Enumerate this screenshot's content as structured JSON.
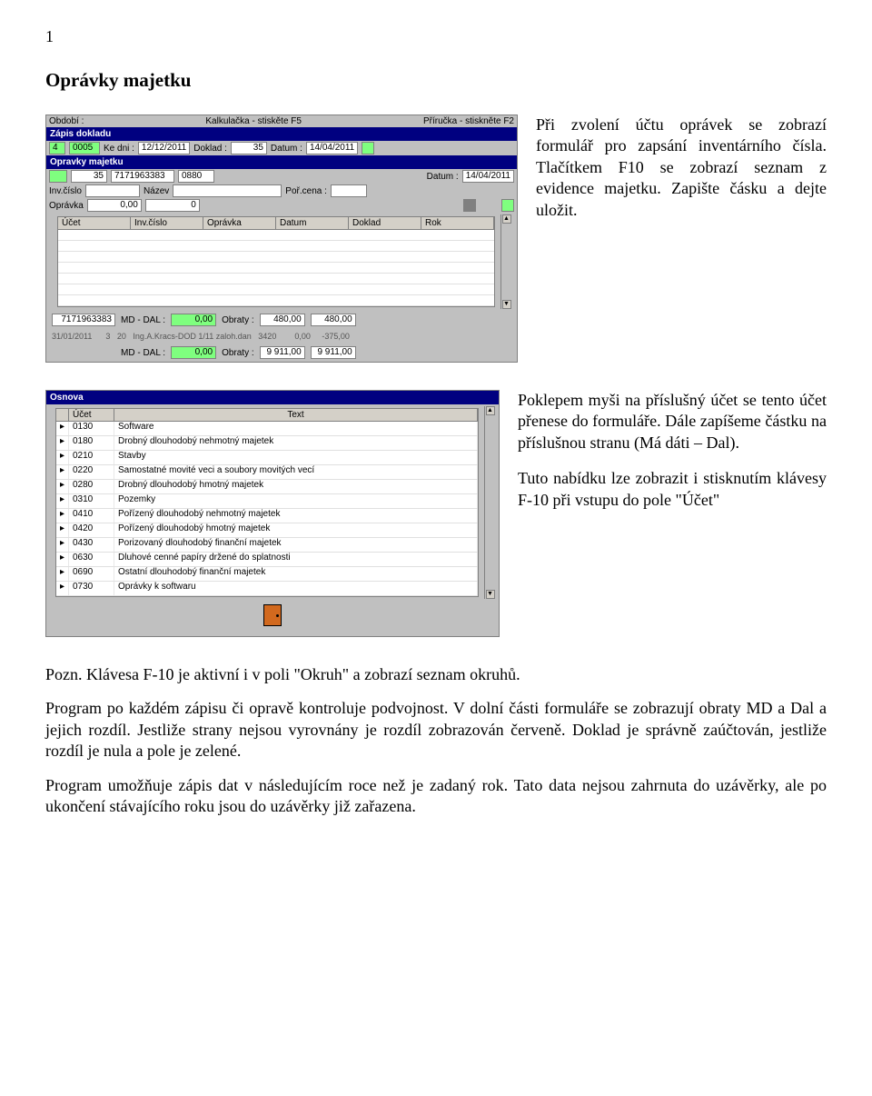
{
  "page_number": "1",
  "title": "Oprávky majetku",
  "para1": "Při zvolení účtu oprávek se zobrazí formulář pro zapsání inventárního čísla. Tlačítkem F10 se zobrazí seznam z evidence majetku. Zapište čásku a dejte uložit.",
  "para2": "Poklepem myši na příslušný účet se tento účet přenese do formuláře. Dále zapíšeme částku na příslušnou stranu (Má dáti – Dal).",
  "para3": "Tuto nabídku lze zobrazit i stisknutím klávesy F-10 při vstupu do pole \"Účet\"",
  "pozn": "Pozn. Klávesa F-10 je aktivní i v poli \"Okruh\" a zobrazí seznam okruhů.",
  "body1": "Program po každém zápisu či opravě kontroluje podvojnost. V dolní části formuláře se zobrazují obraty MD a Dal a jejich rozdíl. Jestliže strany nejsou vyrovnány je rozdíl zobrazován červeně. Doklad je správně zaúčtován, jestliže rozdíl je nula a pole je zelené.",
  "body2": "Program umožňuje zápis dat v následujícím roce než je zadaný rok. Tato data nejsou zahrnuta do uzávěrky, ale po ukončení stávajícího roku jsou do uzávěrky již zařazena.",
  "shot1": {
    "top_labels": {
      "obdobi": "Období :",
      "kalk": "Kalkulačka - stiskěte F5",
      "prir": "Příručka - stiskněte F2"
    },
    "titlebar_zapis": "Zápis dokladu",
    "row_zapis": {
      "f1": "4",
      "f2": "0005",
      "kedni_l": "Ke dni :",
      "kedni": "12/12/2011",
      "doklad_l": "Doklad :",
      "doklad": "35",
      "datum_l": "Datum :",
      "datum": "14/04/2011"
    },
    "titlebar_opr": "Opravky majetku",
    "row_opr": {
      "a": "35",
      "b": "7171963383",
      "c": "0880",
      "datum_l": "Datum :",
      "datum": "14/04/2011"
    },
    "row_inv": {
      "invc_l": "Inv.číslo",
      "nazev_l": "Název",
      "porc_l": "Poř.cena :"
    },
    "row_opr2": {
      "opr_l": "Oprávka",
      "v1": "0,00",
      "v2": "0"
    },
    "table_headers": [
      "Účet",
      "Inv.číslo",
      "Oprávka",
      "Datum",
      "Doklad",
      "Rok"
    ],
    "footer1": {
      "a": "7171963383",
      "mddal_l": "MD - DAL :",
      "mddal": "0,00",
      "obraty_l": "Obraty :",
      "o1": "480,00",
      "o2": "480,00"
    },
    "footer2_pre": "31/01/2011      3   20   Ing.A.Kracs-DOD 1/11 zaloh.dan   3420        0,00     -375,00",
    "footer2": {
      "mddal_l": "MD - DAL :",
      "mddal": "0,00",
      "obraty_l": "Obraty :",
      "o1": "9 911,00",
      "o2": "9 911,00"
    }
  },
  "shot2": {
    "titlebar": "Osnova",
    "headers": {
      "ucet": "Účet",
      "text": "Text"
    },
    "rows": [
      {
        "ucet": "0130",
        "text": "Software"
      },
      {
        "ucet": "0180",
        "text": "Drobný dlouhodobý nehmotný majetek"
      },
      {
        "ucet": "0210",
        "text": "Stavby"
      },
      {
        "ucet": "0220",
        "text": "Samostatné movité veci a soubory movitých vecí"
      },
      {
        "ucet": "0280",
        "text": "Drobný dlouhodobý hmotný majetek"
      },
      {
        "ucet": "0310",
        "text": "Pozemky"
      },
      {
        "ucet": "0410",
        "text": "Pořízený dlouhodobý nehmotný majetek"
      },
      {
        "ucet": "0420",
        "text": "Pořízený dlouhodobý hmotný majetek"
      },
      {
        "ucet": "0430",
        "text": "Porizovaný dlouhodobý finanční majetek"
      },
      {
        "ucet": "0630",
        "text": "Dluhové cenné papíry držené do splatnosti"
      },
      {
        "ucet": "0690",
        "text": "Ostatní dlouhodobý finanční majetek"
      },
      {
        "ucet": "0730",
        "text": "Oprávky k softwaru"
      }
    ]
  }
}
